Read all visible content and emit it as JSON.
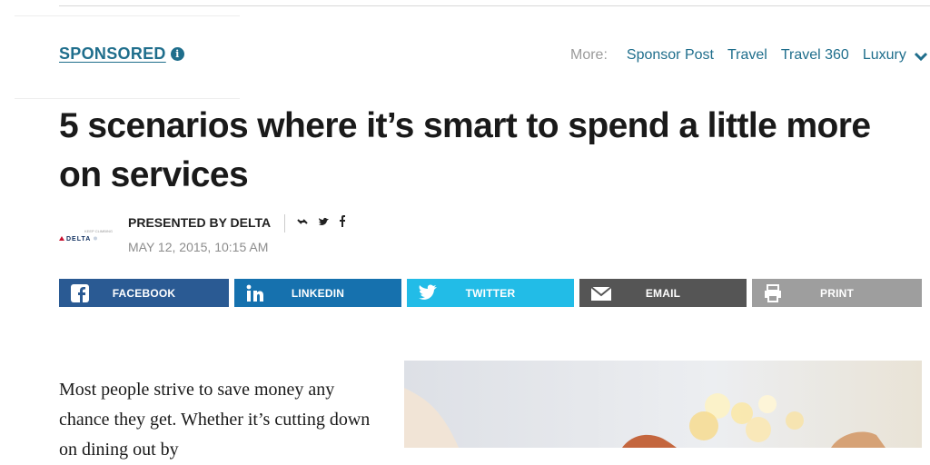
{
  "section": {
    "label": "SPONSORED",
    "info_icon": "info-icon"
  },
  "more_nav": {
    "label": "More:",
    "links": [
      "Sponsor Post",
      "Travel",
      "Travel 360",
      "Luxury"
    ],
    "expand_icon": "chevron-down-icon"
  },
  "article": {
    "title": "5 scenarios where it’s smart to spend a little more on services",
    "presented_by": "PRESENTED BY DELTA",
    "date": "MAY 12, 2015, 10:15 AM",
    "sponsor_logo": {
      "text": "DELTA",
      "tagline": "KEEP CLIMBING"
    },
    "body": "Most people strive to save money any chance they get. Whether it’s cutting down on dining out by"
  },
  "share": {
    "facebook": "FACEBOOK",
    "linkedin": "LINKEDIN",
    "twitter": "TWITTER",
    "email": "EMAIL",
    "print": "PRINT"
  },
  "colors": {
    "accent": "#1f6e8c",
    "facebook": "#2a5a93",
    "linkedin": "#1671ae",
    "twitter": "#22bce7",
    "email": "#555555",
    "print": "#9e9e9e"
  }
}
